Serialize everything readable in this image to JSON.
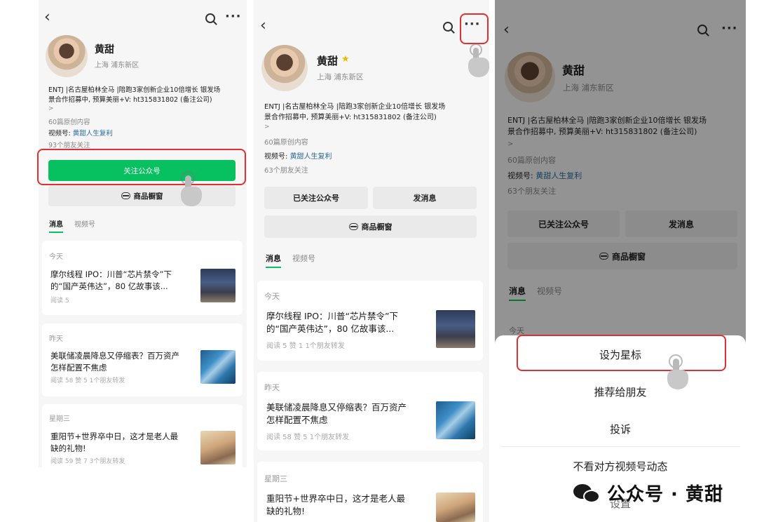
{
  "profile": {
    "name": "黄甜",
    "location": "上海 浦东新区",
    "bio_line1": "ENTJ |名古屋柏林全马 |陪跑3家创新企业10倍增长 银发场",
    "bio_line2": "景合作招募中, 预算美丽+V:  ht315831802 (备注公司)",
    "chevron": ">",
    "articles": "60篇原创内容",
    "video_label": "视频号:",
    "video_name": "黄甜人生复利",
    "followers_p1": "93个朋友关注",
    "followers_p2": "63个朋友关注"
  },
  "buttons": {
    "follow": "关注公众号",
    "followed": "已关注公众号",
    "message": "发消息",
    "shop": "商品橱窗"
  },
  "tabs": {
    "messages": "消息",
    "video": "视频号"
  },
  "articles": [
    {
      "day": "今天",
      "title1": "摩尔线程 IPO：川普“芯片禁令”下",
      "title2": "的“国产英伟达”，80 亿故事该...",
      "stats_p1": "阅读 5",
      "stats_p2": "阅读 5   赞 1   1个朋友转发"
    },
    {
      "day": "昨天",
      "title1": "美联储凌晨降息又停缩表？百万资产",
      "title2": "怎样配置不焦虑",
      "stats": "阅读 58   赞 5   1个朋友转发"
    },
    {
      "day": "星期三",
      "title1": "重阳节+世界卒中日，这才是老人最",
      "title2": "缺的礼物!",
      "stats": "阅读 59   赞 7   3个朋友转发"
    }
  ],
  "icons": {
    "back": "‹",
    "more": "···",
    "star": "★"
  },
  "sheet": {
    "peek_day": "今天",
    "star": "设为星标",
    "recommend": "推荐给朋友",
    "report": "投诉",
    "hide_video": "不看对方视频号动态",
    "settings": "设置"
  },
  "watermark": {
    "text": "公众号 · 黄甜"
  },
  "colors": {
    "accent_green": "#07c160",
    "highlight_red": "#e0302f",
    "link_blue": "#2a6a9e",
    "star_gold": "#f5b800"
  }
}
